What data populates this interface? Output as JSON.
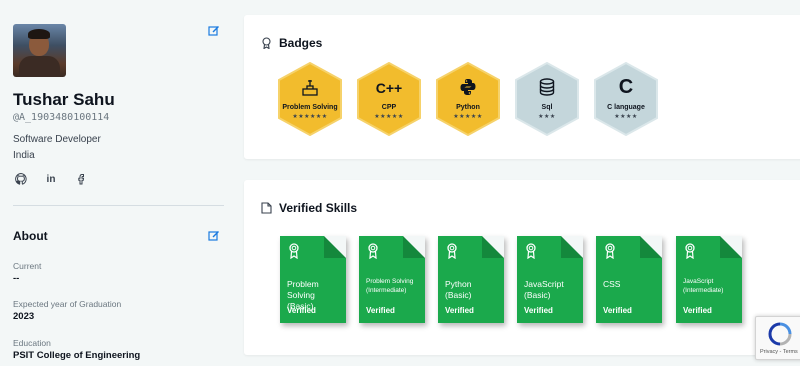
{
  "profile": {
    "name": "Tushar Sahu",
    "handle": "@A_1903480100114",
    "role": "Software Developer",
    "country": "India",
    "socials": [
      "github-icon",
      "linkedin-icon",
      "facebook-icon"
    ]
  },
  "about": {
    "title": "About",
    "fields": [
      {
        "label": "Current",
        "value": "--"
      },
      {
        "label": "Expected year of Graduation",
        "value": "2023"
      },
      {
        "label": "Education",
        "value": "PSIT College of Engineering"
      }
    ]
  },
  "badges": {
    "title": "Badges",
    "items": [
      {
        "name": "Problem Solving",
        "glyph": "",
        "icon": "problem-solving-icon",
        "stars": "★★★★★★",
        "tier": "gold"
      },
      {
        "name": "CPP",
        "glyph": "C++",
        "icon": "cpp-icon",
        "stars": "★★★★★",
        "tier": "gold"
      },
      {
        "name": "Python",
        "glyph": "",
        "icon": "python-icon",
        "stars": "★★★★★",
        "tier": "gold"
      },
      {
        "name": "Sql",
        "glyph": "",
        "icon": "database-icon",
        "stars": "★★★",
        "tier": "silver"
      },
      {
        "name": "C language",
        "glyph": "C",
        "icon": "c-language-icon",
        "stars": "★★★★",
        "tier": "silver"
      }
    ]
  },
  "skills": {
    "title": "Verified Skills",
    "items": [
      {
        "name": "Problem Solving (Basic)",
        "status": "Verified",
        "size": "normal"
      },
      {
        "name": "Problem Solving (Intermediate)",
        "status": "Verified",
        "size": "small"
      },
      {
        "name": "Python (Basic)",
        "status": "Verified",
        "size": "normal"
      },
      {
        "name": "JavaScript (Basic)",
        "status": "Verified",
        "size": "normal"
      },
      {
        "name": "CSS",
        "status": "Verified",
        "size": "normal"
      },
      {
        "name": "JavaScript (Intermediate)",
        "status": "Verified",
        "size": "small"
      }
    ]
  },
  "recaptcha": {
    "text": "Privacy - Terms"
  },
  "colors": {
    "gold": "#f2bc2d",
    "gold_border": "#f6d26a",
    "silver": "#c4d6db",
    "silver_border": "#dbe7ea",
    "verified_green": "#1ba94c",
    "page_bg": "#f3f7f7"
  }
}
